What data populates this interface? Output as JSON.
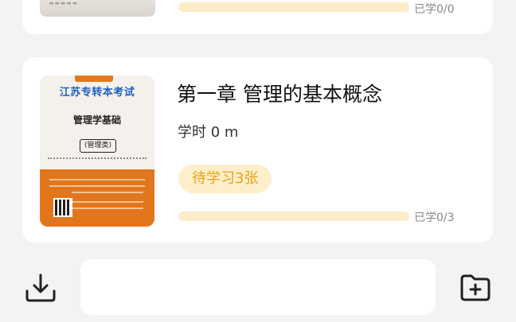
{
  "items": [
    {
      "learned_text": "已学0/0",
      "progress": 0
    },
    {
      "title": "第一章 管理的基本概念",
      "hours": "学时 0 m",
      "pending": "待学习3张",
      "learned_text": "已学0/3",
      "progress": 0,
      "cover": {
        "title": "江苏专转本考试",
        "subtitle": "管理学基础",
        "edition": "(管理类)"
      }
    }
  ],
  "bottom": {
    "download_icon": "download-icon",
    "input_value": "",
    "add_icon": "folder-add-icon"
  },
  "colors": {
    "accent": "#f7b640",
    "progress_track": "#fdecc8",
    "pending_bg": "#fdefc9",
    "pending_text": "#e9a21b"
  }
}
